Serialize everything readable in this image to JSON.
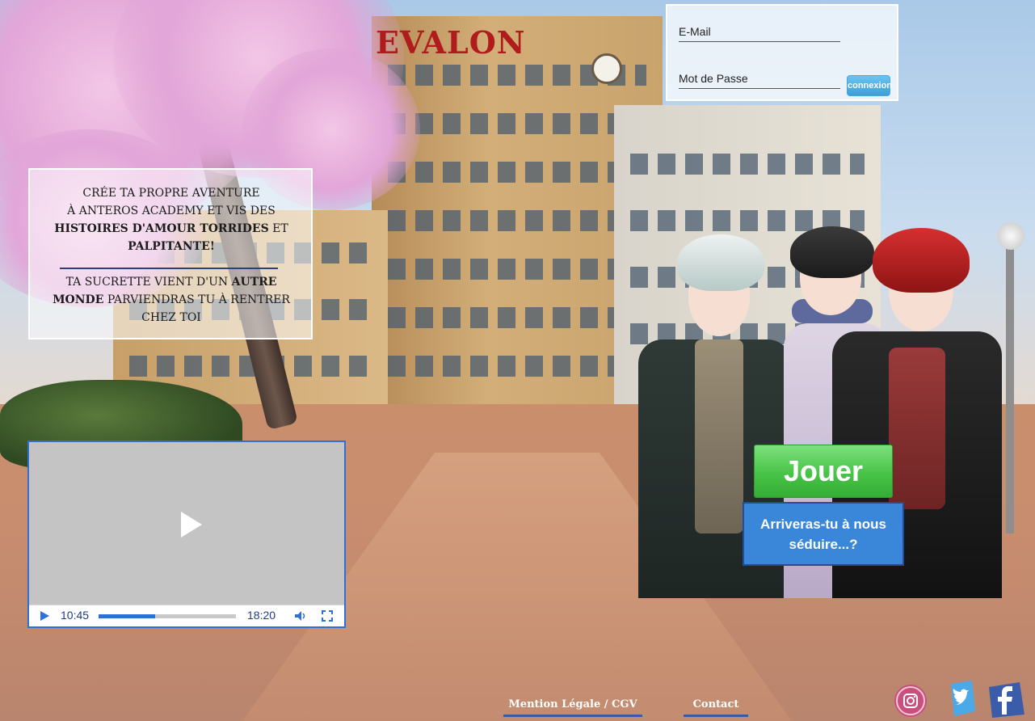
{
  "site": {
    "title": "EVALON"
  },
  "login": {
    "email_placeholder": "E-Mail",
    "password_placeholder": "Mot de Passe",
    "submit_label": "connexion"
  },
  "intro": {
    "line1": "CRÉE TA PROPRE AVENTURE",
    "line2": "À ANTEROS ACADEMY ET VIS DES",
    "line3_bold": "HISTOIRES D'AMOUR TORRIDES",
    "line3_rest": " ET",
    "line4_bold": "PALPITANTE!",
    "line5": "TA SUCRETTE VIENT D'UN ",
    "line5_bold": "AUTRE",
    "line6_bold": "MONDE",
    "line6_rest": " PARVIENDRAS TU À RENTRER",
    "line7": "CHEZ TOI"
  },
  "video": {
    "current_time": "10:45",
    "total_time": "18:20",
    "progress": 0.41
  },
  "cta": {
    "play_label": "Jouer",
    "tagline_line1": "Arriveras-tu à nous",
    "tagline_line2": "séduire...?"
  },
  "footer": {
    "legal_label": "Mention Légale / CGV",
    "contact_label": "Contact"
  },
  "social": {
    "items": [
      {
        "name": "instagram",
        "icon": "instagram-icon"
      },
      {
        "name": "twitter",
        "icon": "twitter-icon"
      },
      {
        "name": "facebook",
        "icon": "facebook-icon"
      }
    ]
  },
  "colors": {
    "title_red": "#b01c1c",
    "play_green": "#47c447",
    "tagline_blue": "#3a86d9",
    "video_border_blue": "#2f6fd6",
    "connexion_blue": "#3d9fd6"
  }
}
